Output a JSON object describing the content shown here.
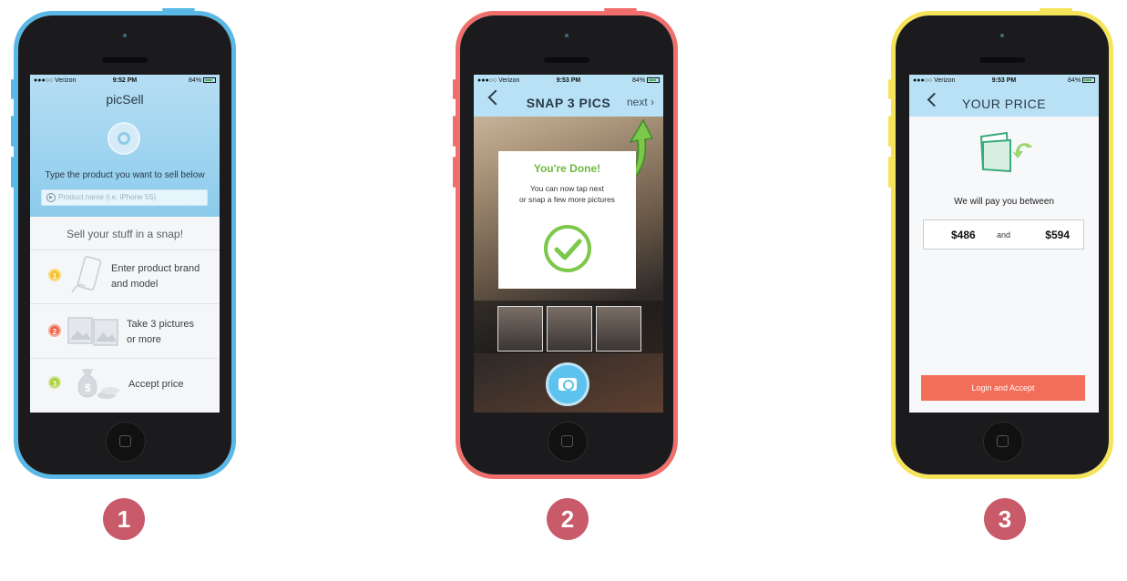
{
  "status_bar": {
    "carrier": "●●●○○ Verizon",
    "battery_percent": "84%",
    "times": [
      "9:52 PM",
      "9:53 PM",
      "9:53 PM"
    ]
  },
  "screen1": {
    "app_title": "picSell",
    "prompt": "Type the product you want to sell below",
    "search_placeholder": "Product name (i.e. iPhone 5S)",
    "tagline": "Sell your stuff in a snap!",
    "steps": [
      {
        "number": "1",
        "line1": "Enter product brand",
        "line2": "and model",
        "color": "#f5c330"
      },
      {
        "number": "2",
        "line1": "Take 3 pictures",
        "line2": "or more",
        "color": "#ef6448"
      },
      {
        "number": "3",
        "line1": "Accept price",
        "line2": "",
        "color": "#a8cf3a"
      }
    ]
  },
  "screen2": {
    "title": "SNAP 3 PICS",
    "next_label": "next",
    "done_heading": "You're Done!",
    "done_line1": "You can now tap next",
    "done_line2": "or snap a few more pictures"
  },
  "screen3": {
    "title": "YOUR PRICE",
    "pay_text": "We will pay you between",
    "price_low": "$486",
    "and_text": "and",
    "price_high": "$594",
    "accept_button": "Login and Accept"
  },
  "step_badges": [
    "1",
    "2",
    "3"
  ],
  "colors": {
    "phone1_frame": "#5ab8e6",
    "phone2_frame": "#f06f6c",
    "phone3_frame": "#f5e45a",
    "badge": "#c85a6a",
    "accent_green": "#6cb942",
    "accept_button": "#f26e58",
    "header_blue": "#b9e1f5"
  }
}
